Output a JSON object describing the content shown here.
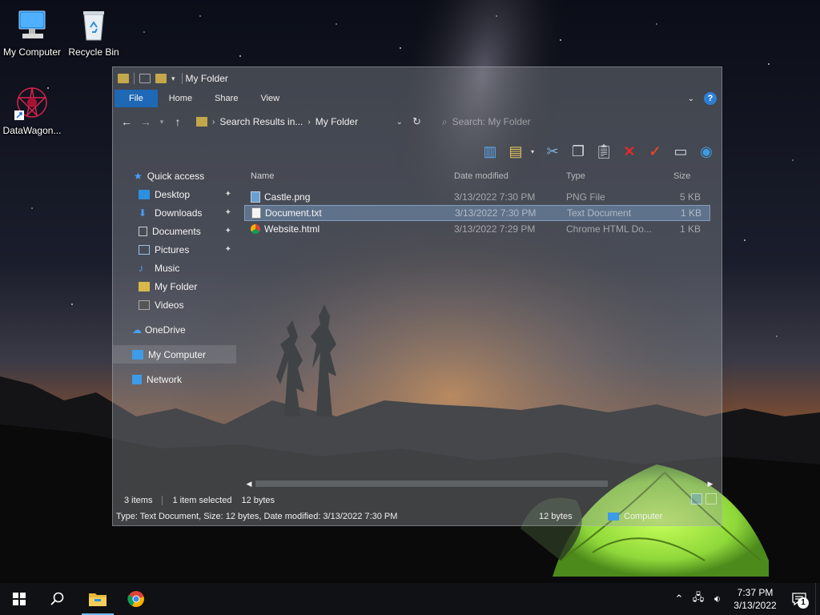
{
  "desktop": {
    "icons": [
      {
        "label": "My Computer"
      },
      {
        "label": "Recycle Bin"
      },
      {
        "label": "DataWagon..."
      }
    ]
  },
  "explorer": {
    "title": "My Folder",
    "ribbon_tabs": [
      "File",
      "Home",
      "Share",
      "View"
    ],
    "address": {
      "part1": "Search Results in...",
      "part2": "My Folder"
    },
    "search_placeholder": "Search: My Folder",
    "nav": {
      "quick_access": "Quick access",
      "items": [
        "Desktop",
        "Downloads",
        "Documents",
        "Pictures",
        "Music",
        "My Folder",
        "Videos"
      ],
      "onedrive": "OneDrive",
      "my_computer": "My Computer",
      "network": "Network"
    },
    "columns": {
      "name": "Name",
      "date": "Date modified",
      "type": "Type",
      "size": "Size"
    },
    "files": [
      {
        "name": "Castle.png",
        "date": "3/13/2022 7:30 PM",
        "type": "PNG File",
        "size": "5 KB",
        "selected": false
      },
      {
        "name": "Document.txt",
        "date": "3/13/2022 7:30 PM",
        "type": "Text Document",
        "size": "1 KB",
        "selected": true
      },
      {
        "name": "Website.html",
        "date": "3/13/2022 7:29 PM",
        "type": "Chrome HTML Do...",
        "size": "1 KB",
        "selected": false
      }
    ],
    "status": {
      "count": "3 items",
      "selected": "1 item selected",
      "bytes": "12 bytes"
    },
    "detail": {
      "text": "Type: Text Document, Size: 12 bytes, Date modified: 3/13/2022 7:30 PM",
      "size": "12 bytes",
      "zone": "Computer"
    }
  },
  "taskbar": {
    "time": "7:37 PM",
    "date": "3/13/2022",
    "notification_count": "1"
  },
  "colors": {
    "file_tab": "#1e6ec8",
    "selection": "#8cbef0",
    "taskbar": "#101114",
    "tent": "#9be23a"
  }
}
